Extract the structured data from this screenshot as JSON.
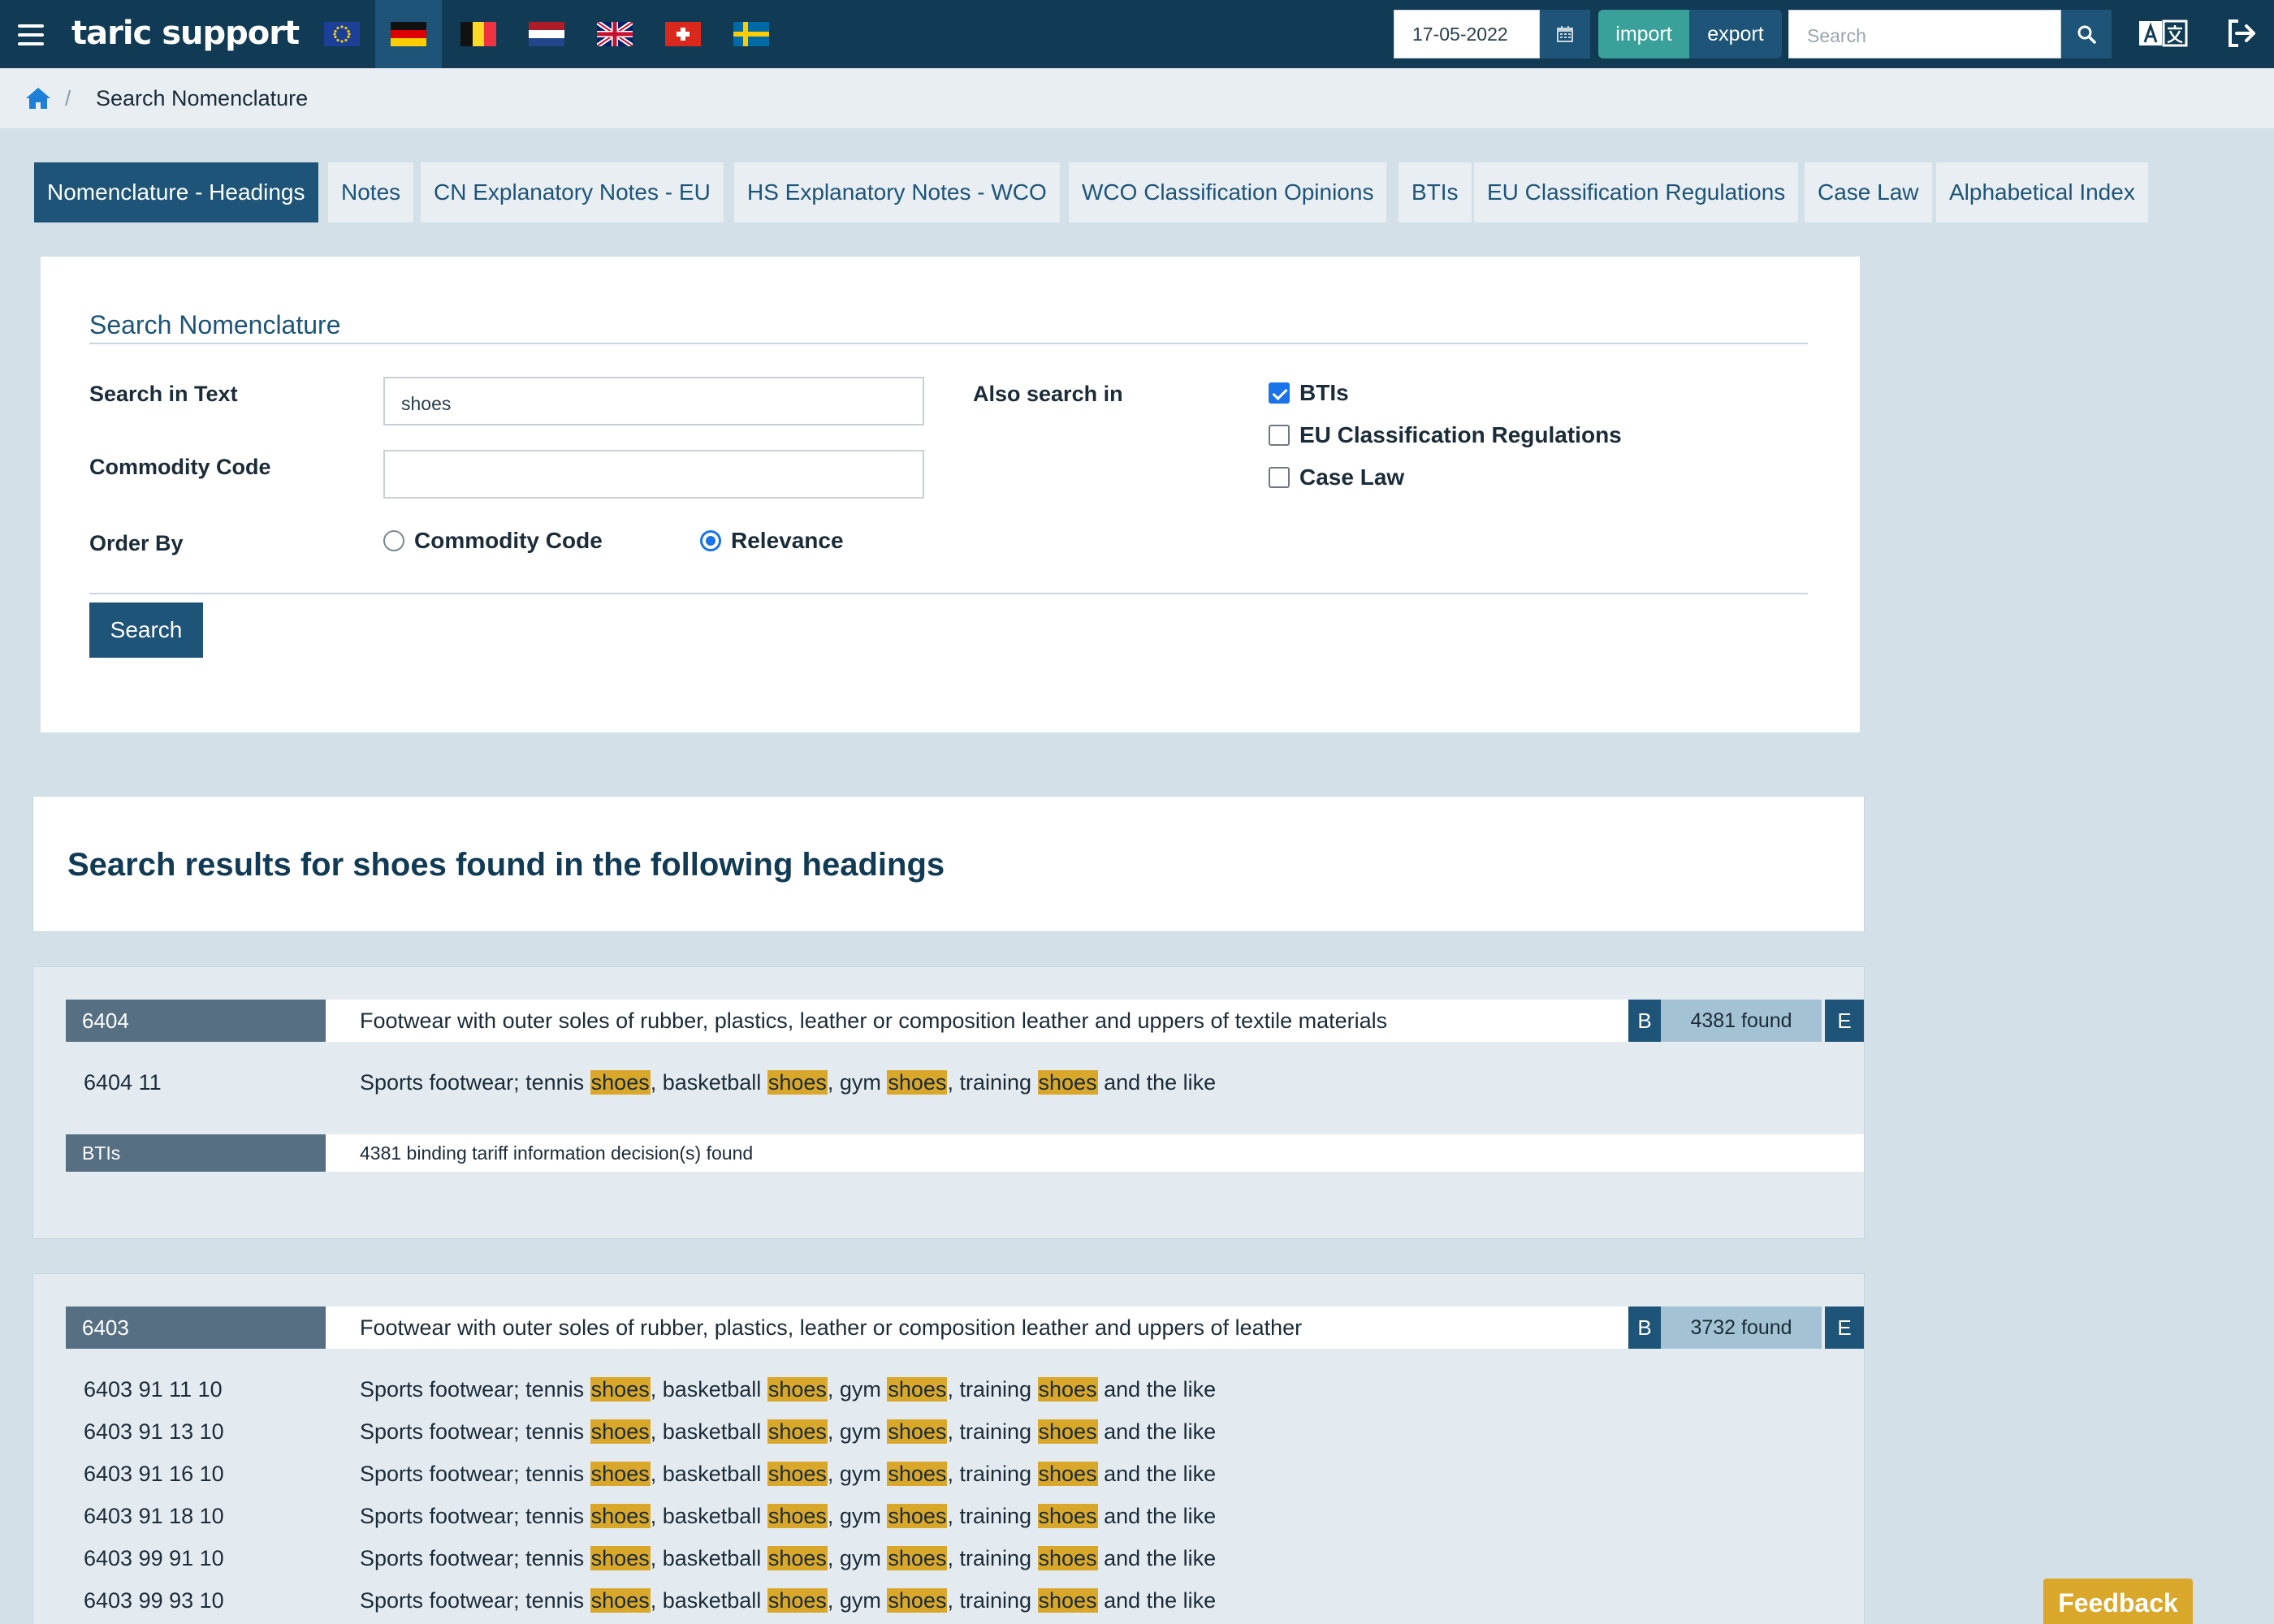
{
  "header": {
    "logo": "taric support",
    "flags": [
      "eu-flag",
      "de-flag",
      "be-flag",
      "nl-flag",
      "uk-flag",
      "ch-flag",
      "se-flag"
    ],
    "active_flag": "de-flag",
    "date": "17-05-2022",
    "import_label": "import",
    "export_label": "export",
    "search_placeholder": "Search"
  },
  "breadcrumb": {
    "current": "Search Nomenclature",
    "separator": "/"
  },
  "tabs": [
    "Nomenclature - Headings",
    "Notes",
    "CN Explanatory Notes - EU",
    "HS Explanatory Notes - WCO",
    "WCO Classification Opinions",
    "BTIs",
    "EU Classification Regulations",
    "Case Law",
    "Alphabetical Index"
  ],
  "search_form": {
    "title": "Search Nomenclature",
    "text_label": "Search in Text",
    "text_value": "shoes",
    "code_label": "Commodity Code",
    "code_value": "",
    "order_label": "Order By",
    "order_options": [
      "Commodity Code",
      "Relevance"
    ],
    "order_selected": "Relevance",
    "also_label": "Also search in",
    "also_options": [
      {
        "label": "BTIs",
        "checked": true
      },
      {
        "label": "EU Classification Regulations",
        "checked": false
      },
      {
        "label": "Case Law",
        "checked": false
      }
    ],
    "button": "Search"
  },
  "results": {
    "heading": "Search results for shoes found in the following headings",
    "groups": [
      {
        "code": "6404",
        "description": "Footwear with outer soles of rubber, plastics, leather or composition leather and uppers of textile materials",
        "b": "B",
        "found": "4381 found",
        "e": "E",
        "rows": [
          {
            "code": "6404 11"
          }
        ],
        "bti_label": "BTIs",
        "bti_text": "4381 binding tariff information decision(s) found"
      },
      {
        "code": "6403",
        "description": "Footwear with outer soles of rubber, plastics, leather or composition leather and uppers of leather",
        "b": "B",
        "found": "3732 found",
        "e": "E",
        "rows": [
          {
            "code": "6403 91 11 10"
          },
          {
            "code": "6403 91 13 10"
          },
          {
            "code": "6403 91 16 10"
          },
          {
            "code": "6403 91 18 10"
          },
          {
            "code": "6403 99 91 10"
          },
          {
            "code": "6403 99 93 10"
          }
        ]
      }
    ],
    "row_text": {
      "p1": "Sports footwear; tennis ",
      "p2": ", basketball ",
      "p3": ", gym ",
      "p4": ", training ",
      "p5": " and the like",
      "highlight": "shoes"
    }
  },
  "feedback_label": "Feedback",
  "colors": {
    "topbar": "#113a55",
    "accent": "#1d5478",
    "import": "#3aa19a",
    "highlight": "#d9a82b",
    "page_bg": "#d3e0e8"
  }
}
